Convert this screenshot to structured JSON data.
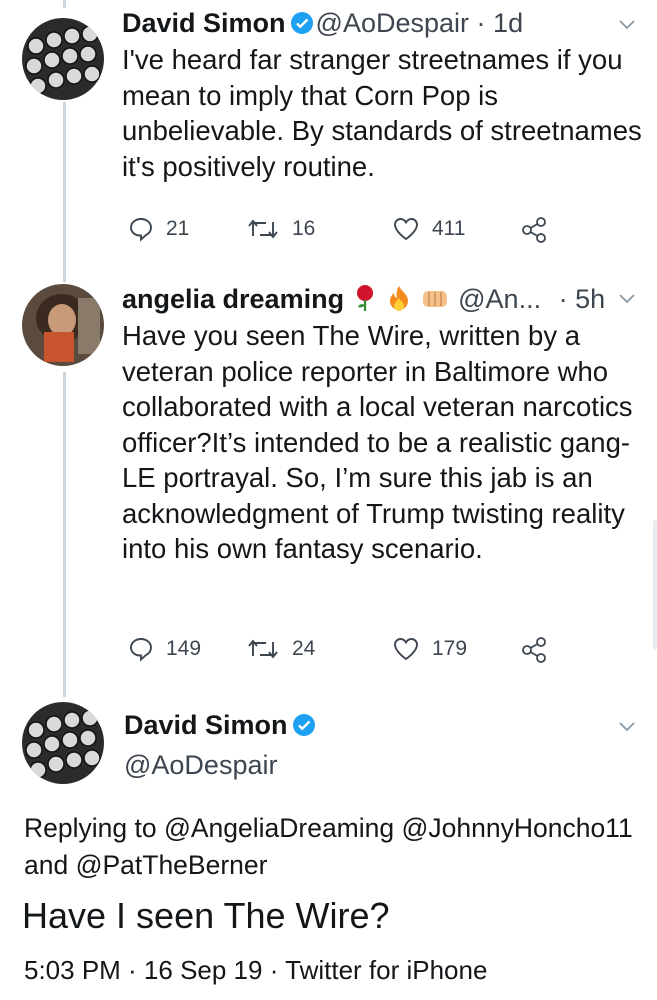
{
  "tweets": [
    {
      "name": "David Simon",
      "handle": "@AoDespair",
      "separator": "·",
      "time": "1d",
      "text": "I've heard far stranger streetnames if you mean to imply that Corn Pop is unbelievable. By standards of streetnames it's positively routine.",
      "replies": "21",
      "retweets": "16",
      "likes": "411"
    },
    {
      "name": "angelia dreaming",
      "handle": "@An...",
      "separator": "·",
      "time": "5h",
      "text": "Have you seen The Wire, written by a veteran police reporter in Baltimore who collaborated with a local veteran narcotics officer?It’s intended to be a realistic gang-LE portrayal. So, I’m sure this jab is an acknowledgment of Trump twisting reality into his own fantasy scenario.",
      "replies": "149",
      "retweets": "24",
      "likes": "179"
    }
  ],
  "main_tweet": {
    "name": "David Simon",
    "handle": "@AoDespair",
    "replying_to": "Replying to @AngeliaDreaming @JohnnyHoncho11 and @PatTheBerner",
    "text": "Have I seen The Wire?",
    "meta": "5:03 PM · 16 Sep 19 · Twitter for iPhone"
  },
  "colors": {
    "verified": "#1da1f2",
    "text": "#14171a",
    "secondary": "#3d4650",
    "thread_line": "#ccd6dd"
  },
  "icons": [
    "verified-badge-icon",
    "chevron-down-icon",
    "reply-icon",
    "retweet-icon",
    "like-icon",
    "share-icon",
    "rose-emoji-icon",
    "fire-emoji-icon",
    "fist-emoji-icon"
  ]
}
